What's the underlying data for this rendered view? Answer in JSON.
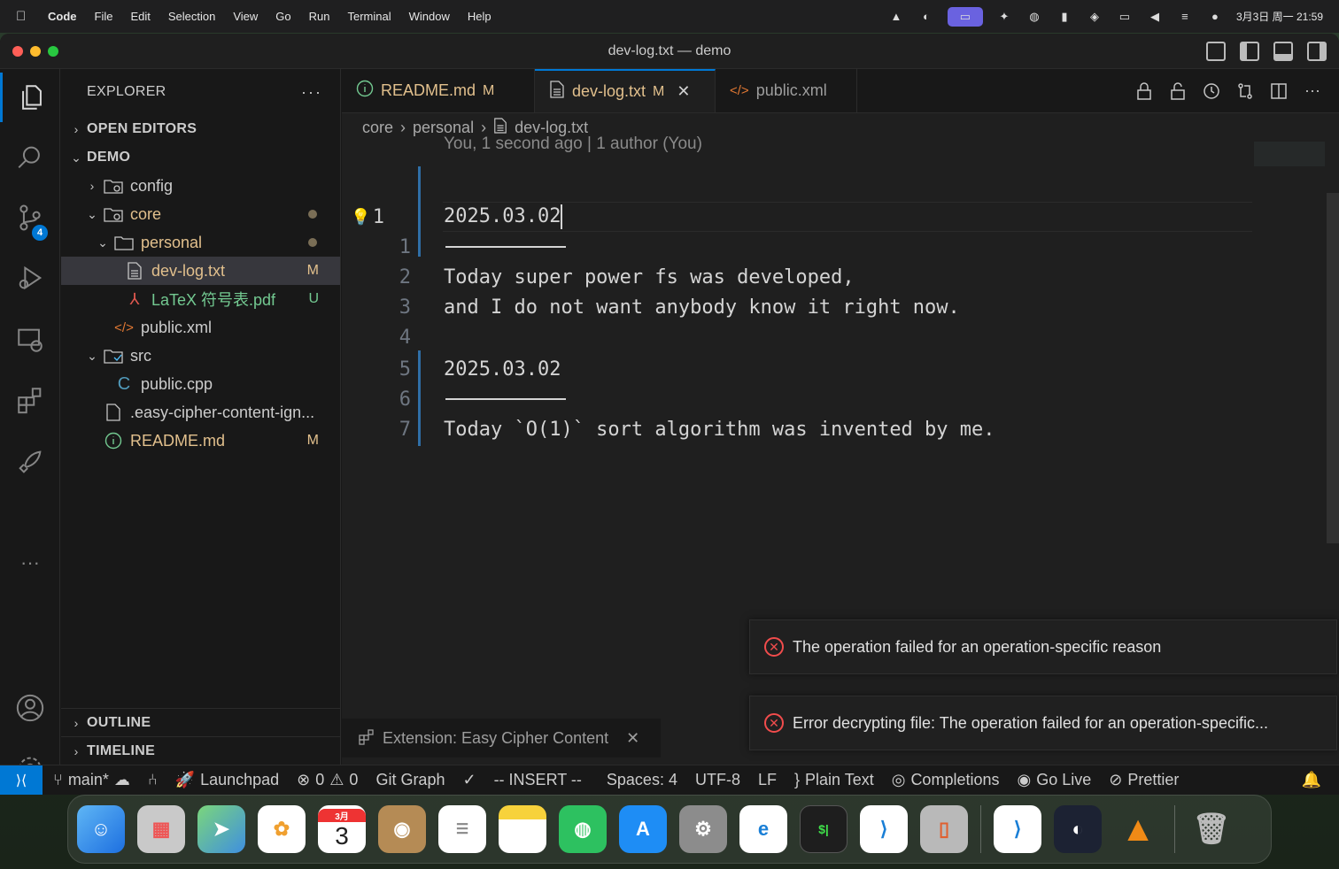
{
  "menubar": {
    "app": "Code",
    "items": [
      "File",
      "Edit",
      "Selection",
      "View",
      "Go",
      "Run",
      "Terminal",
      "Window",
      "Help"
    ],
    "clock": "3月3日 周一 21:59"
  },
  "window": {
    "title": "dev-log.txt — demo"
  },
  "activity": {
    "scm_badge": "4"
  },
  "explorer": {
    "title": "EXPLORER",
    "more": "···",
    "open_editors": "OPEN EDITORS",
    "root": "DEMO",
    "tree": [
      {
        "label": "config"
      },
      {
        "label": "core"
      },
      {
        "label": "personal"
      },
      {
        "label": "dev-log.txt",
        "status": "M"
      },
      {
        "label": "LaTeX 符号表.pdf",
        "status": "U"
      },
      {
        "label": "public.xml"
      },
      {
        "label": "src"
      },
      {
        "label": "public.cpp"
      },
      {
        "label": ".easy-cipher-content-ign..."
      },
      {
        "label": "README.md",
        "status": "M"
      }
    ],
    "outline": "OUTLINE",
    "timeline": "TIMELINE"
  },
  "tabs": [
    {
      "label": "README.md",
      "status": "M"
    },
    {
      "label": "dev-log.txt",
      "status": "M",
      "close": "✕"
    },
    {
      "label": "public.xml"
    }
  ],
  "breadcrumb": [
    "core",
    "personal",
    "dev-log.txt"
  ],
  "editor": {
    "blame": "You, 1 second ago | 1 author (You)",
    "lines": [
      {
        "num": "1",
        "text": "2025.03.02"
      },
      {
        "num": "1",
        "text": ""
      },
      {
        "num": "2",
        "text": "Today super power fs was developed,"
      },
      {
        "num": "3",
        "text": "and I do not want anybody know it right now."
      },
      {
        "num": "4",
        "text": ""
      },
      {
        "num": "5",
        "text": "2025.03.02"
      },
      {
        "num": "6",
        "text": ""
      },
      {
        "num": "7",
        "text": "Today `O(1)` sort algorithm was invented by me."
      }
    ]
  },
  "panel_tab": {
    "label": "Extension: Easy Cipher Content"
  },
  "notifications": [
    "The operation failed for an operation-specific reason",
    "Error decrypting file: The operation failed for an operation-specific..."
  ],
  "statusbar": {
    "branch": "main*",
    "launchpad": "Launchpad",
    "errors": "0",
    "warnings": "0",
    "git_graph": "Git Graph",
    "mode": "-- INSERT --",
    "spaces": "Spaces: 4",
    "encoding": "UTF-8",
    "eol": "LF",
    "language": "Plain Text",
    "completions": "Completions",
    "go_live": "Go Live",
    "prettier": "Prettier"
  },
  "dock": {
    "calendar_month": "3月",
    "calendar_day": "3",
    "apps": [
      "finder-icon",
      "launchpad-icon",
      "maps-icon",
      "photos-icon",
      "calendar-icon",
      "contacts-icon",
      "reminders-icon",
      "notes-icon",
      "wechat-icon",
      "app-store-icon",
      "system-settings-icon",
      "edge-icon",
      "terminal-icon",
      "vscode-icon",
      "iphone-mirroring-icon",
      "vscode-icon",
      "obs-icon",
      "vlc-icon",
      "trash-icon"
    ]
  }
}
